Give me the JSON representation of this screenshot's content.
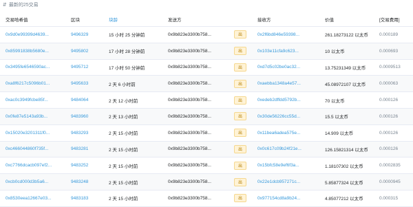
{
  "header": {
    "sort_icon": "sort-icon",
    "title": "最新的25交易"
  },
  "columns": {
    "hash": "交易哈希值",
    "block": "区块",
    "age": "块龄",
    "from": "发送方",
    "direction": "",
    "to": "接收方",
    "value": "价值",
    "fee": "[交易费用]"
  },
  "rows": [
    {
      "hash": "0x9d0e99399d4639...",
      "block": "9496329",
      "age": "15 小时 25 分钟前",
      "from": "0x9b823e3300b758...",
      "dir": "出",
      "to": "0x2f6bd846e59398...",
      "value": "261.18273122 以太币",
      "fee": "0.000189"
    },
    {
      "hash": "0x85991838b5680e...",
      "block": "9495802",
      "age": "17 小时 28 分钟前",
      "from": "0x9b823e3300b758...",
      "dir": "出",
      "to": "0x103e11cfa9c623...",
      "value": "10 以太币",
      "fee": "0.000693"
    },
    {
      "hash": "0x3495fe6546590ac...",
      "block": "9495712",
      "age": "17 小时 50 分钟前",
      "from": "0x9b823e3300b758...",
      "dir": "出",
      "to": "0xd7d5c02be0ac32...",
      "value": "13.75231349 以太币",
      "fee": "0.0009513"
    },
    {
      "hash": "0xa8f6217c5096b01...",
      "block": "9495633",
      "age": "2 天 6 小时前",
      "from": "0x9b823e3300b758...",
      "dir": "出",
      "to": "0xaebba1348a4e57...",
      "value": "45.08972107 以太币",
      "fee": "0.000063"
    },
    {
      "hash": "0xac0c3949fcbe85f...",
      "block": "9484064",
      "age": "2 天 12 小时前",
      "from": "0x9b823e3300b758...",
      "dir": "出",
      "to": "0xedeb2dffdd5792b...",
      "value": "70 以太币",
      "fee": "0.000126"
    },
    {
      "hash": "0x0fe87e5143a93b...",
      "block": "9483960",
      "age": "2 天 13 小时前",
      "from": "0x9b823e3300b758...",
      "dir": "出",
      "to": "0x30de56226cc55d...",
      "value": "15.5 以太币",
      "fee": "0.000126"
    },
    {
      "hash": "0x15020e3201311f0...",
      "block": "9483293",
      "age": "2 天 15 小时前",
      "from": "0x9b823e3300b758...",
      "dir": "出",
      "to": "0x11bea6adea575e...",
      "value": "14.909 以太币",
      "fee": "0.000126"
    },
    {
      "hash": "0xc466044860f735f...",
      "block": "9483281",
      "age": "2 天 15 小时前",
      "from": "0x9b823e3300b758...",
      "dir": "出",
      "to": "0x0c617c09b24f21e...",
      "value": "126.15821314 以太币",
      "fee": "0.000126"
    },
    {
      "hash": "0xc7766dcacb097ef2...",
      "block": "9483252",
      "age": "2 天 15 小时前",
      "from": "0x9b823e3300b758...",
      "dir": "出",
      "to": "0x15bfc58e9ef6f3a...",
      "value": "1.18107302 以太币",
      "fee": "0.0002835"
    },
    {
      "hash": "0xcb0cd000d3b5a6...",
      "block": "9483248",
      "age": "2 天 15 小时前",
      "from": "0x9b823e3300b758...",
      "dir": "出",
      "to": "0x22e1dcb957271c...",
      "value": "5.85877324 以太币",
      "fee": "0.0000945"
    },
    {
      "hash": "0x8530eea12667e03...",
      "block": "9483183",
      "age": "2 天 15 小时前",
      "from": "0x9b823e3300b758...",
      "dir": "出",
      "to": "0x977154cd8a9b24...",
      "value": "4.85077212 以太币",
      "fee": "0.000315"
    }
  ],
  "colors": {
    "link": "#3498db",
    "text": "#1e2022",
    "border": "#e7eaf3",
    "badge_bg": "#fff3d6"
  }
}
